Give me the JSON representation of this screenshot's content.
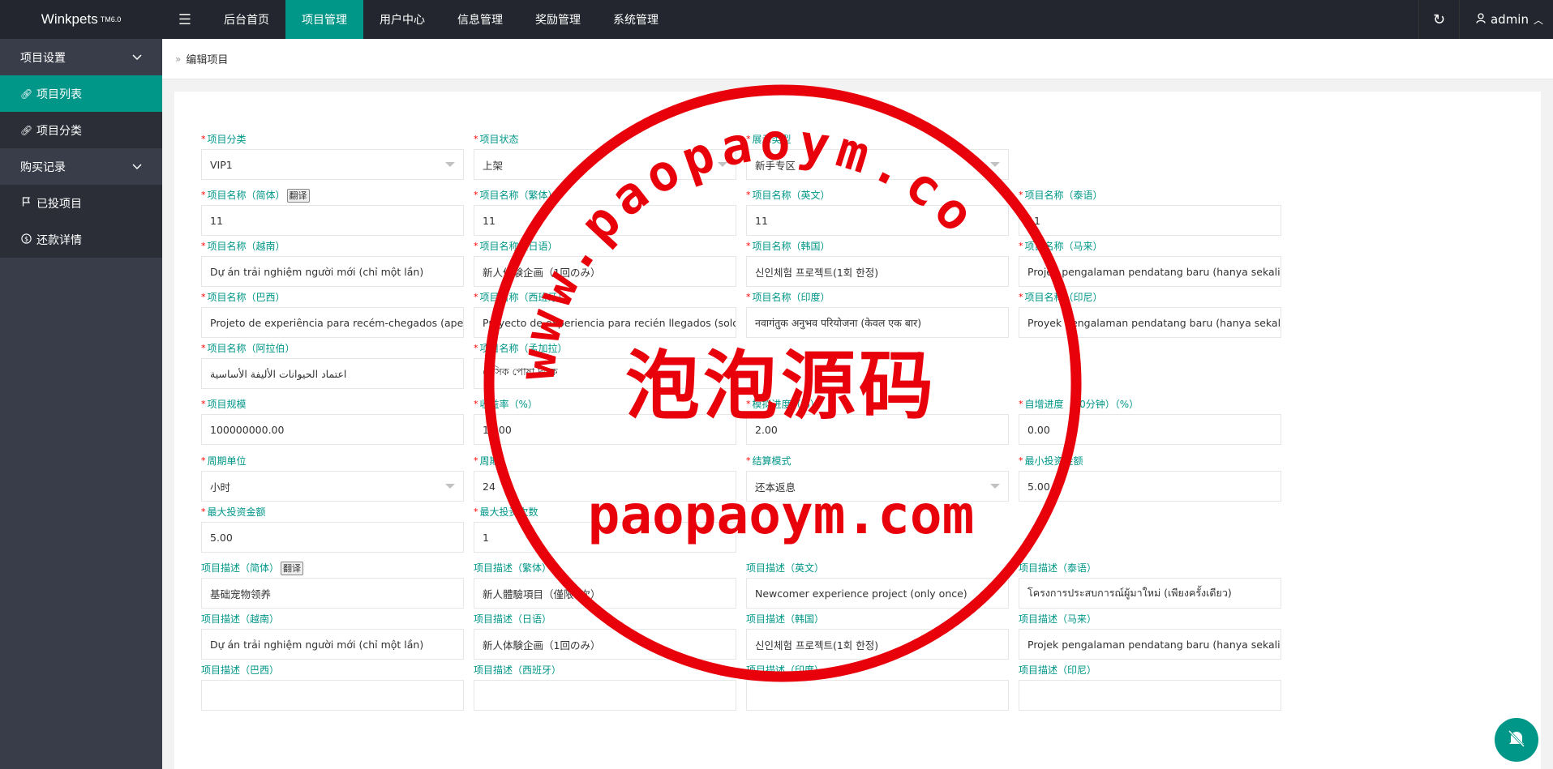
{
  "app": {
    "logo": "Winkpets",
    "version": "TM6.0"
  },
  "topnav": {
    "items": [
      "后台首页",
      "项目管理",
      "用户中心",
      "信息管理",
      "奖励管理",
      "系统管理"
    ],
    "user": "admin"
  },
  "sidebar": {
    "group1": "项目设置",
    "item_list": "项目列表",
    "item_category": "项目分类",
    "group2": "购买记录",
    "item_invested": "已投项目",
    "item_repay": "还款详情"
  },
  "breadcrumb": "编辑项目",
  "translate_label": "翻译",
  "fields": [
    {
      "label": "项目分类",
      "value": "VIP1",
      "req": true,
      "select": true
    },
    {
      "label": "项目状态",
      "value": "上架",
      "req": true,
      "select": true
    },
    {
      "label": "展示类型",
      "value": "新手专区",
      "req": true,
      "select": true
    },
    {
      "label": "项目名称（简体）",
      "value": "11",
      "req": true,
      "translate": true
    },
    {
      "label": "项目名称（繁体）",
      "value": "11",
      "req": true
    },
    {
      "label": "项目名称（英文）",
      "value": "11",
      "req": true
    },
    {
      "label": "项目名称（泰语）",
      "value": "11",
      "req": true
    },
    {
      "label": "项目名称（越南）",
      "value": "Dự án trải nghiệm người mới (chỉ một lần)",
      "req": true
    },
    {
      "label": "项目名称（日语）",
      "value": "新人体験企画（1回のみ）",
      "req": true
    },
    {
      "label": "项目名称（韩国）",
      "value": "신인체험 프로젝트(1회 한정)",
      "req": true
    },
    {
      "label": "项目名称（马来）",
      "value": "Projek pengalaman pendatang baru (hanya sekali)",
      "req": true
    },
    {
      "label": "项目名称（巴西）",
      "value": "Projeto de experiência para recém-chegados (apenas uma vez)",
      "req": true
    },
    {
      "label": "项目名称（西班牙）",
      "value": "Proyecto de experiencia para recién llegados (solo una vez)",
      "req": true
    },
    {
      "label": "项目名称（印度）",
      "value": "नवागंतुक अनुभव परियोजना (केवल एक बार)",
      "req": true
    },
    {
      "label": "项目名称（印尼）",
      "value": "Proyek pengalaman pendatang baru (hanya sekali)",
      "req": true
    },
    {
      "label": "项目名称（阿拉伯）",
      "value": "اعتماد الحيوانات الأليفة الأساسية",
      "req": true
    },
    {
      "label": "项目名称（孟加拉）",
      "value": "বেসিক পোষা দত্তক",
      "req": true
    },
    {
      "label": "项目规模",
      "value": "100000000.00",
      "req": true
    },
    {
      "label": "收益率（%）",
      "value": "10.00",
      "req": true
    },
    {
      "label": "模拟进度（%）",
      "value": "2.00",
      "req": true
    },
    {
      "label": "自增进度（30分钟）（%）",
      "value": "0.00",
      "req": true
    },
    {
      "label": "周期单位",
      "value": "小时",
      "req": true,
      "select": true
    },
    {
      "label": "周期",
      "value": "24",
      "req": true
    },
    {
      "label": "结算模式",
      "value": "还本返息",
      "req": true,
      "select": true
    },
    {
      "label": "最小投资金额",
      "value": "5.00",
      "req": true
    },
    {
      "label": "最大投资金额",
      "value": "5.00",
      "req": true
    },
    {
      "label": "最大投资次数",
      "value": "1",
      "req": true
    },
    {
      "label": "项目描述（简体）",
      "value": "基础宠物领养",
      "req": false,
      "translate": true
    },
    {
      "label": "项目描述（繁体）",
      "value": "新人體驗項目（僅限1次）",
      "req": false
    },
    {
      "label": "项目描述（英文）",
      "value": "Newcomer experience project (only once)",
      "req": false
    },
    {
      "label": "项目描述（泰语）",
      "value": "โครงการประสบการณ์ผู้มาใหม่ (เพียงครั้งเดียว)",
      "req": false
    },
    {
      "label": "项目描述（越南）",
      "value": "Dự án trải nghiệm người mới (chỉ một lần)",
      "req": false
    },
    {
      "label": "项目描述（日语）",
      "value": "新人体験企画（1回のみ）",
      "req": false
    },
    {
      "label": "项目描述（韩国）",
      "value": "신인체험 프로젝트(1회 한정)",
      "req": false
    },
    {
      "label": "项目描述（马来）",
      "value": "Projek pengalaman pendatang baru (hanya sekali)",
      "req": false
    },
    {
      "label": "项目描述（巴西）",
      "value": "",
      "req": false
    },
    {
      "label": "项目描述（西班牙）",
      "value": "",
      "req": false
    },
    {
      "label": "项目描述（印度）",
      "value": "",
      "req": false
    },
    {
      "label": "项目描述（印尼）",
      "value": "",
      "req": false
    }
  ],
  "watermark": {
    "arc_text": "www.paopaoym.com",
    "chinese": "泡泡源码",
    "domain": "paopaoym.com",
    "color": "#e8000b"
  },
  "colors": {
    "accent": "#009688",
    "topbar": "#23262e",
    "sidebar": "#393d49",
    "label": "#009688",
    "required": "#ff0000"
  }
}
